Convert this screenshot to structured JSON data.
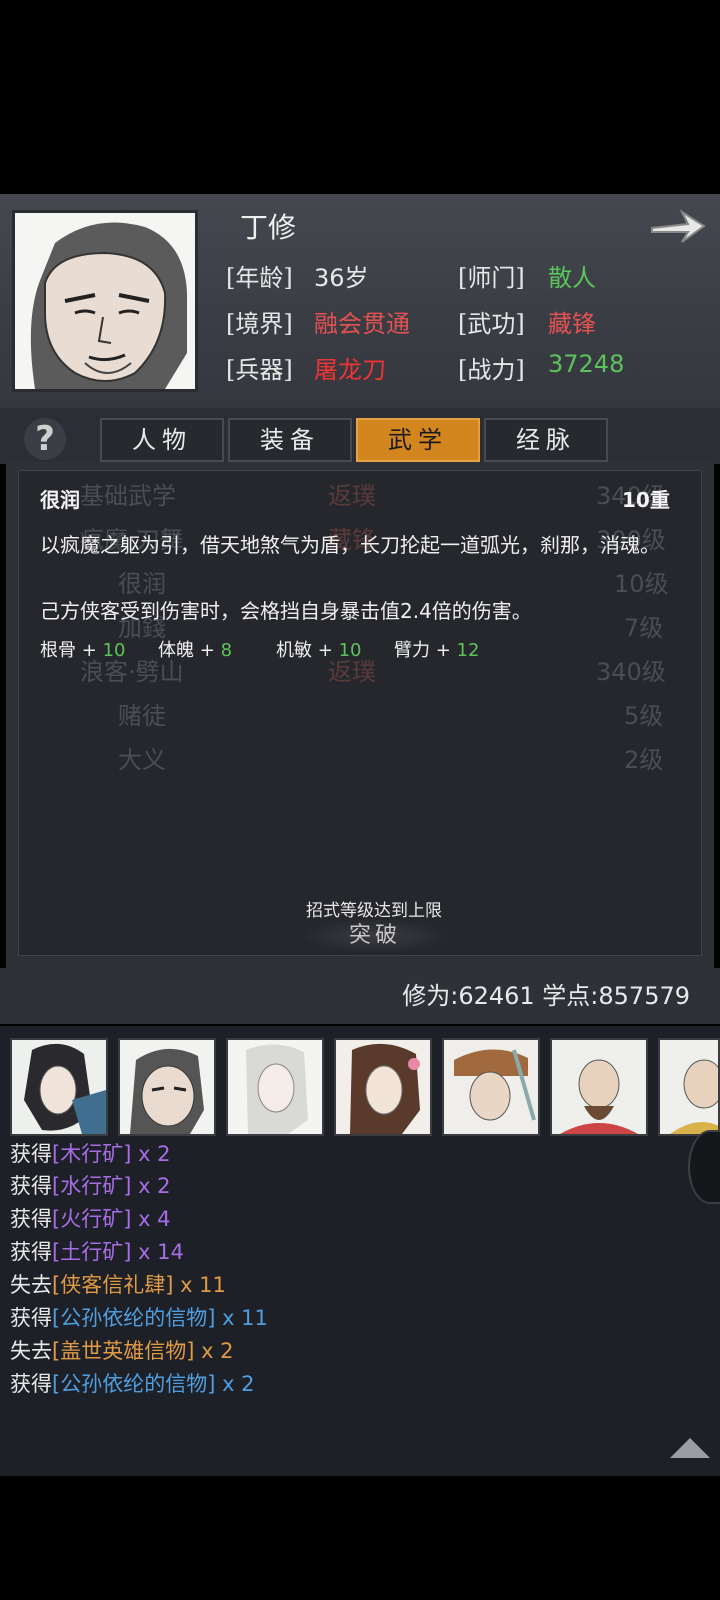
{
  "character": {
    "name": "丁修",
    "age_label": "[年龄]",
    "age_value": "36岁",
    "sect_label": "[师门]",
    "sect_value": "散人",
    "realm_label": "[境界]",
    "realm_value": "融会贯通",
    "skill_label": "[武功]",
    "skill_value": "藏锋",
    "weapon_label": "[兵器]",
    "weapon_value": "屠龙刀",
    "power_label": "[战力]",
    "power_value": "37248"
  },
  "tabs": [
    {
      "label": "人物"
    },
    {
      "label": "装备"
    },
    {
      "label": "武学",
      "active": true
    },
    {
      "label": "经脉"
    }
  ],
  "help_icon": "?",
  "skill_list": [
    {
      "name": "基础武学",
      "tag": "返璞",
      "level": "340级"
    },
    {
      "name": "疯魔·刀舞",
      "tag": "藏锋",
      "level": "300级"
    },
    {
      "name": "很润",
      "tag": "",
      "level": "10级"
    },
    {
      "name": "加錢",
      "tag": "",
      "level": "7级"
    },
    {
      "name": "浪客·劈山",
      "tag": "返璞",
      "level": "340级"
    },
    {
      "name": "赌徒",
      "tag": "",
      "level": "5级"
    },
    {
      "name": "大义",
      "tag": "",
      "level": "2级"
    }
  ],
  "tooltip": {
    "title": "很润",
    "level": "10重",
    "desc1": "以疯魔之躯为引，借天地煞气为盾，长刀抡起一道弧光，刹那，消魂。",
    "desc2": "己方侠客受到伤害时，会格挡自身暴击值2.4倍的伤害。",
    "attrs": [
      {
        "name": "根骨",
        "plus": "+",
        "value": "10"
      },
      {
        "name": "体魄",
        "plus": "+",
        "value": "8"
      },
      {
        "name": "机敏",
        "plus": "+",
        "value": "10"
      },
      {
        "name": "臂力",
        "plus": "+",
        "value": "12"
      }
    ]
  },
  "limit_text": "招式等级达到上限",
  "breakthrough_label": "突破",
  "cultivation_text": "修为:62461  学点:857579",
  "log": [
    {
      "verb": "获得",
      "item": "[木行矿]",
      "count": " x 2",
      "color": "#a86de6"
    },
    {
      "verb": "获得",
      "item": "[水行矿]",
      "count": " x 2",
      "color": "#a86de6"
    },
    {
      "verb": "获得",
      "item": "[火行矿]",
      "count": " x 4",
      "color": "#a86de6"
    },
    {
      "verb": "获得",
      "item": "[土行矿]",
      "count": " x 14",
      "color": "#a86de6"
    },
    {
      "verb": "失去",
      "item": "[侠客信礼肆]",
      "count": " x 11",
      "color": "#e09a45"
    },
    {
      "verb": "获得",
      "item": "[公孙依纶的信物]",
      "count": " x 11",
      "color": "#4f9fe0"
    },
    {
      "verb": "失去",
      "item": "[盖世英雄信物]",
      "count": " x 2",
      "color": "#e09a45"
    },
    {
      "verb": "获得",
      "item": "[公孙依纶的信物]",
      "count": " x 2",
      "color": "#4f9fe0"
    }
  ],
  "colors": {
    "accent_tab": "#d4861e",
    "green": "#5cc35c",
    "red": "#e04848",
    "purple": "#a86de6",
    "orange": "#e09a45",
    "blue": "#4f9fe0"
  },
  "icons": [
    "help-icon",
    "arrow-right-icon",
    "scroll-up-icon"
  ]
}
